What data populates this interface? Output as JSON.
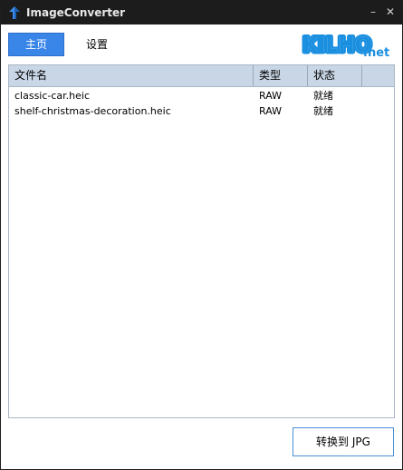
{
  "window": {
    "title": "ImageConverter",
    "minimize_glyph": "–",
    "close_glyph": "✕",
    "icon": "blue-arrow-up-icon"
  },
  "nav": {
    "home_label": "主页",
    "settings_label": "设置"
  },
  "logo": {
    "text_main": "KILHO",
    "text_suffix": ".net",
    "color": "#1a8fe0"
  },
  "table": {
    "columns": [
      "文件名",
      "类型",
      "状态",
      ""
    ],
    "rows": [
      {
        "name": "classic-car.heic",
        "type": "RAW",
        "status": "就绪"
      },
      {
        "name": "shelf-christmas-decoration.heic",
        "type": "RAW",
        "status": "就绪"
      }
    ]
  },
  "actions": {
    "convert_label": "转换到 JPG"
  },
  "colors": {
    "titlebar": "#1c1c1c",
    "accent": "#3a86e8",
    "header": "#c9d6e6"
  }
}
